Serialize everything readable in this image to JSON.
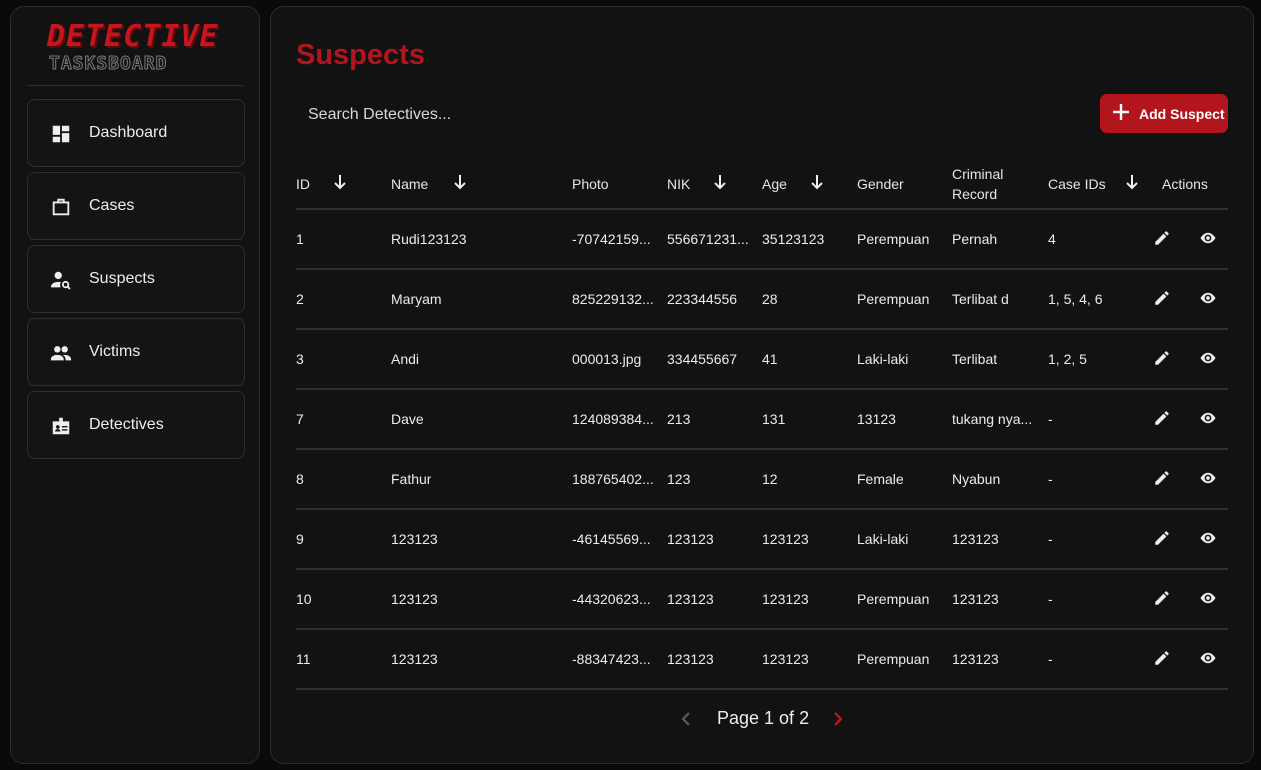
{
  "logo": {
    "line1": "DETECTIVE",
    "line2": "TASKSBOARD"
  },
  "sidebar": {
    "items": [
      {
        "label": "Dashboard",
        "icon": "dashboard-icon"
      },
      {
        "label": "Cases",
        "icon": "briefcase-icon"
      },
      {
        "label": "Suspects",
        "icon": "person-search-icon"
      },
      {
        "label": "Victims",
        "icon": "people-icon"
      },
      {
        "label": "Detectives",
        "icon": "badge-icon"
      }
    ]
  },
  "main": {
    "title": "Suspects",
    "search_placeholder": "Search Detectives...",
    "add_button_label": "Add Suspect",
    "accent": "#b3151c"
  },
  "table": {
    "headers": {
      "id": "ID",
      "name": "Name",
      "photo": "Photo",
      "nik": "NIK",
      "age": "Age",
      "gender": "Gender",
      "criminal_record_1": "Criminal",
      "criminal_record_2": "Record",
      "case_ids": "Case IDs",
      "actions": "Actions"
    },
    "rows": [
      {
        "id": "1",
        "name": "Rudi123123",
        "photo": "-70742159...",
        "nik": "556671231...",
        "age": "35123123",
        "gender": "Perempuan",
        "record": "Pernah",
        "case_ids": "4"
      },
      {
        "id": "2",
        "name": "Maryam",
        "photo": "825229132...",
        "nik": "223344556",
        "age": "28",
        "gender": "Perempuan",
        "record": "Terlibat d",
        "case_ids": "1, 5, 4, 6"
      },
      {
        "id": "3",
        "name": "Andi",
        "photo": "000013.jpg",
        "nik": "334455667",
        "age": "41",
        "gender": "Laki-laki",
        "record": "Terlibat",
        "case_ids": "1, 2, 5"
      },
      {
        "id": "7",
        "name": "Dave",
        "photo": "124089384...",
        "nik": "213",
        "age": "131",
        "gender": "13123",
        "record": "tukang nya...",
        "case_ids": "-"
      },
      {
        "id": "8",
        "name": "Fathur",
        "photo": "188765402...",
        "nik": "123",
        "age": "12",
        "gender": "Female",
        "record": "Nyabun",
        "case_ids": "-"
      },
      {
        "id": "9",
        "name": "123123",
        "photo": "-46145569...",
        "nik": "123123",
        "age": "123123",
        "gender": "Laki-laki",
        "record": "123123",
        "case_ids": "-"
      },
      {
        "id": "10",
        "name": "123123",
        "photo": "-44320623...",
        "nik": "123123",
        "age": "123123",
        "gender": "Perempuan",
        "record": "123123",
        "case_ids": "-"
      },
      {
        "id": "11",
        "name": "123123",
        "photo": "-88347423...",
        "nik": "123123",
        "age": "123123",
        "gender": "Perempuan",
        "record": "123123",
        "case_ids": "-"
      }
    ]
  },
  "pagination": {
    "text": "Page 1 of 2"
  }
}
